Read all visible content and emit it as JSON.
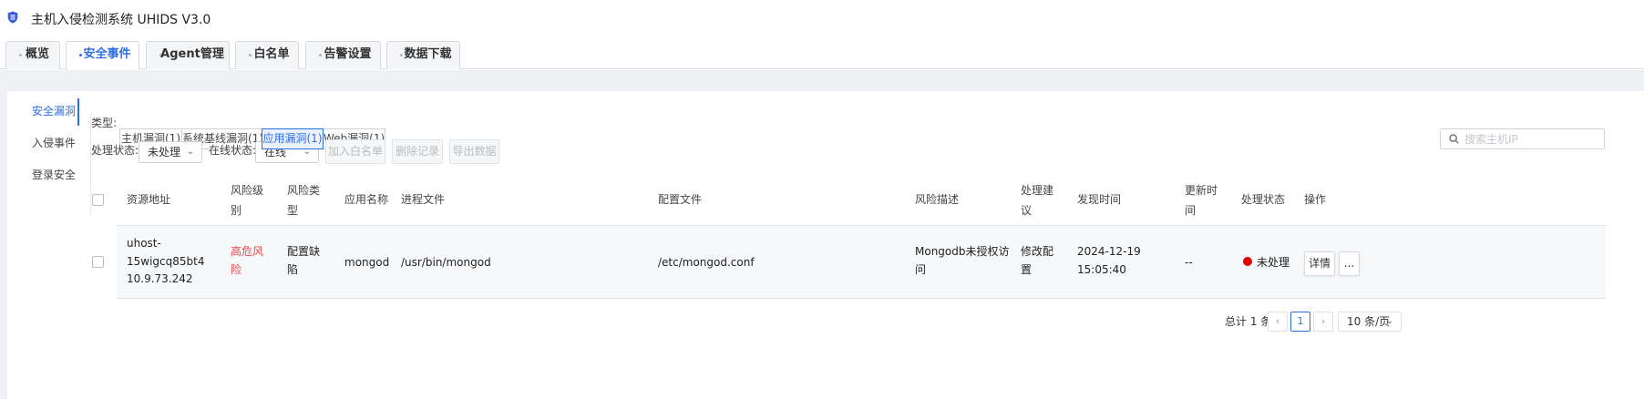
{
  "app": {
    "title": "主机入侵检测系统 UHIDS V3.0"
  },
  "tabs": [
    {
      "label": "概览"
    },
    {
      "label": "安全事件"
    },
    {
      "label": "Agent管理"
    },
    {
      "label": "白名单"
    },
    {
      "label": "告警设置"
    },
    {
      "label": "数据下载"
    }
  ],
  "sidenav": {
    "items": [
      {
        "label": "安全漏洞"
      },
      {
        "label": "入侵事件"
      },
      {
        "label": "登录安全"
      }
    ]
  },
  "filters": {
    "type_label": "类型:",
    "types": [
      {
        "label": "主机漏洞(1)"
      },
      {
        "label": "系统基线漏洞(1)"
      },
      {
        "label": "应用漏洞(1)"
      },
      {
        "label": "Web漏洞(1)"
      }
    ],
    "process_label": "处理状态:",
    "process_value": "未处理",
    "online_label": "在线状态:",
    "online_value": "在线",
    "actions": [
      {
        "label": "加入白名单"
      },
      {
        "label": "删除记录"
      },
      {
        "label": "导出数据"
      }
    ],
    "search_placeholder": "搜索主机IP"
  },
  "table": {
    "headers": {
      "resource": "资源地址",
      "level_1": "风险级",
      "level_2": "别",
      "type_1": "风险类",
      "type_2": "型",
      "app": "应用名称",
      "process": "进程文件",
      "config": "配置文件",
      "desc": "风险描述",
      "advice_1": "处理建",
      "advice_2": "议",
      "found": "发现时间",
      "updated_1": "更新时",
      "updated_2": "间",
      "status": "处理状态",
      "ops": "操作"
    },
    "row": {
      "resource_1": "uhost-",
      "resource_2": "15wigcq85bt4",
      "resource_3": "10.9.73.242",
      "level_1": "高危风",
      "level_2": "险",
      "type_1": "配置缺",
      "type_2": "陷",
      "app": "mongod",
      "process": "/usr/bin/mongod",
      "config": "/etc/mongod.conf",
      "desc_1": "Mongodb未授权访",
      "desc_2": "问",
      "advice_1": "修改配",
      "advice_2": "置",
      "found_1": "2024-12-19",
      "found_2": "15:05:40",
      "updated": "--",
      "status": "未处理",
      "detail_btn": "详情",
      "more_btn": "..."
    }
  },
  "pagination": {
    "total": "总计 1 条",
    "prev": "‹",
    "page": "1",
    "next": "›",
    "size": "10 条/页"
  },
  "colors": {
    "accent": "#2f6fe4",
    "danger": "#e5484d",
    "status_dot": "#e00000"
  }
}
